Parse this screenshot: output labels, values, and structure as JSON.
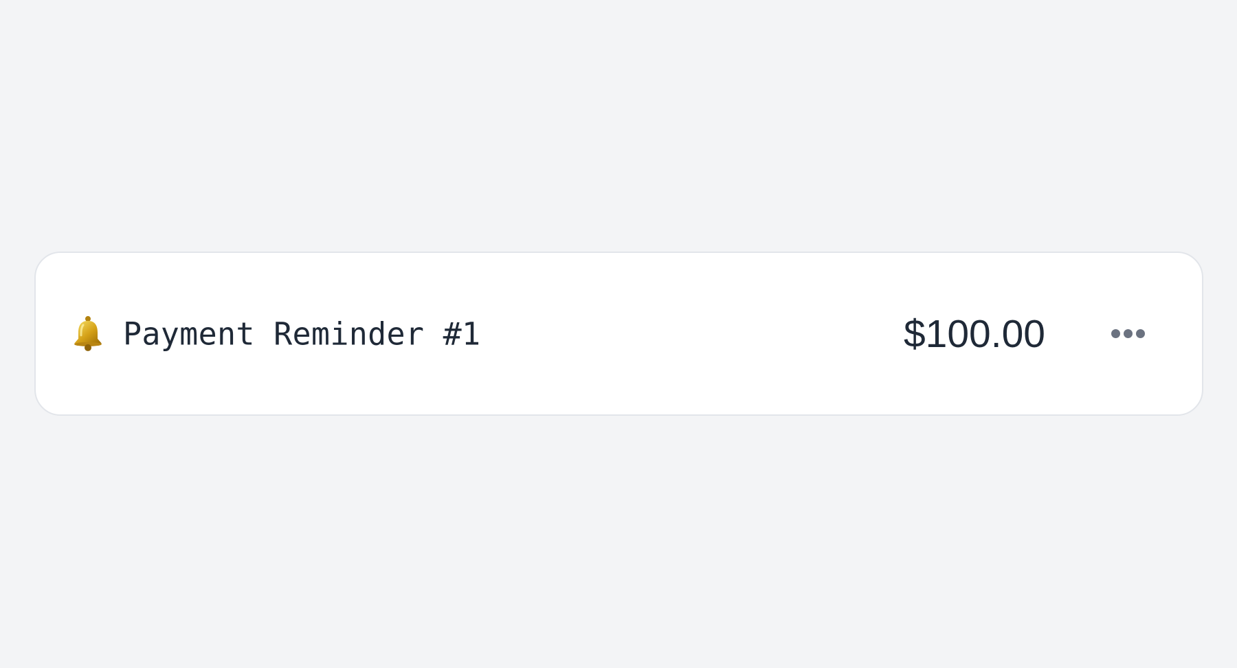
{
  "item": {
    "icon": "bell-icon",
    "title": "Payment Reminder #1",
    "amount": "$100.00",
    "more_icon": "more-horizontal-icon"
  },
  "colors": {
    "background": "#f3f4f6",
    "card": "#ffffff",
    "border": "#e2e5ea",
    "text": "#1f2937",
    "muted": "#6b7280",
    "bell": "#d4a017"
  }
}
